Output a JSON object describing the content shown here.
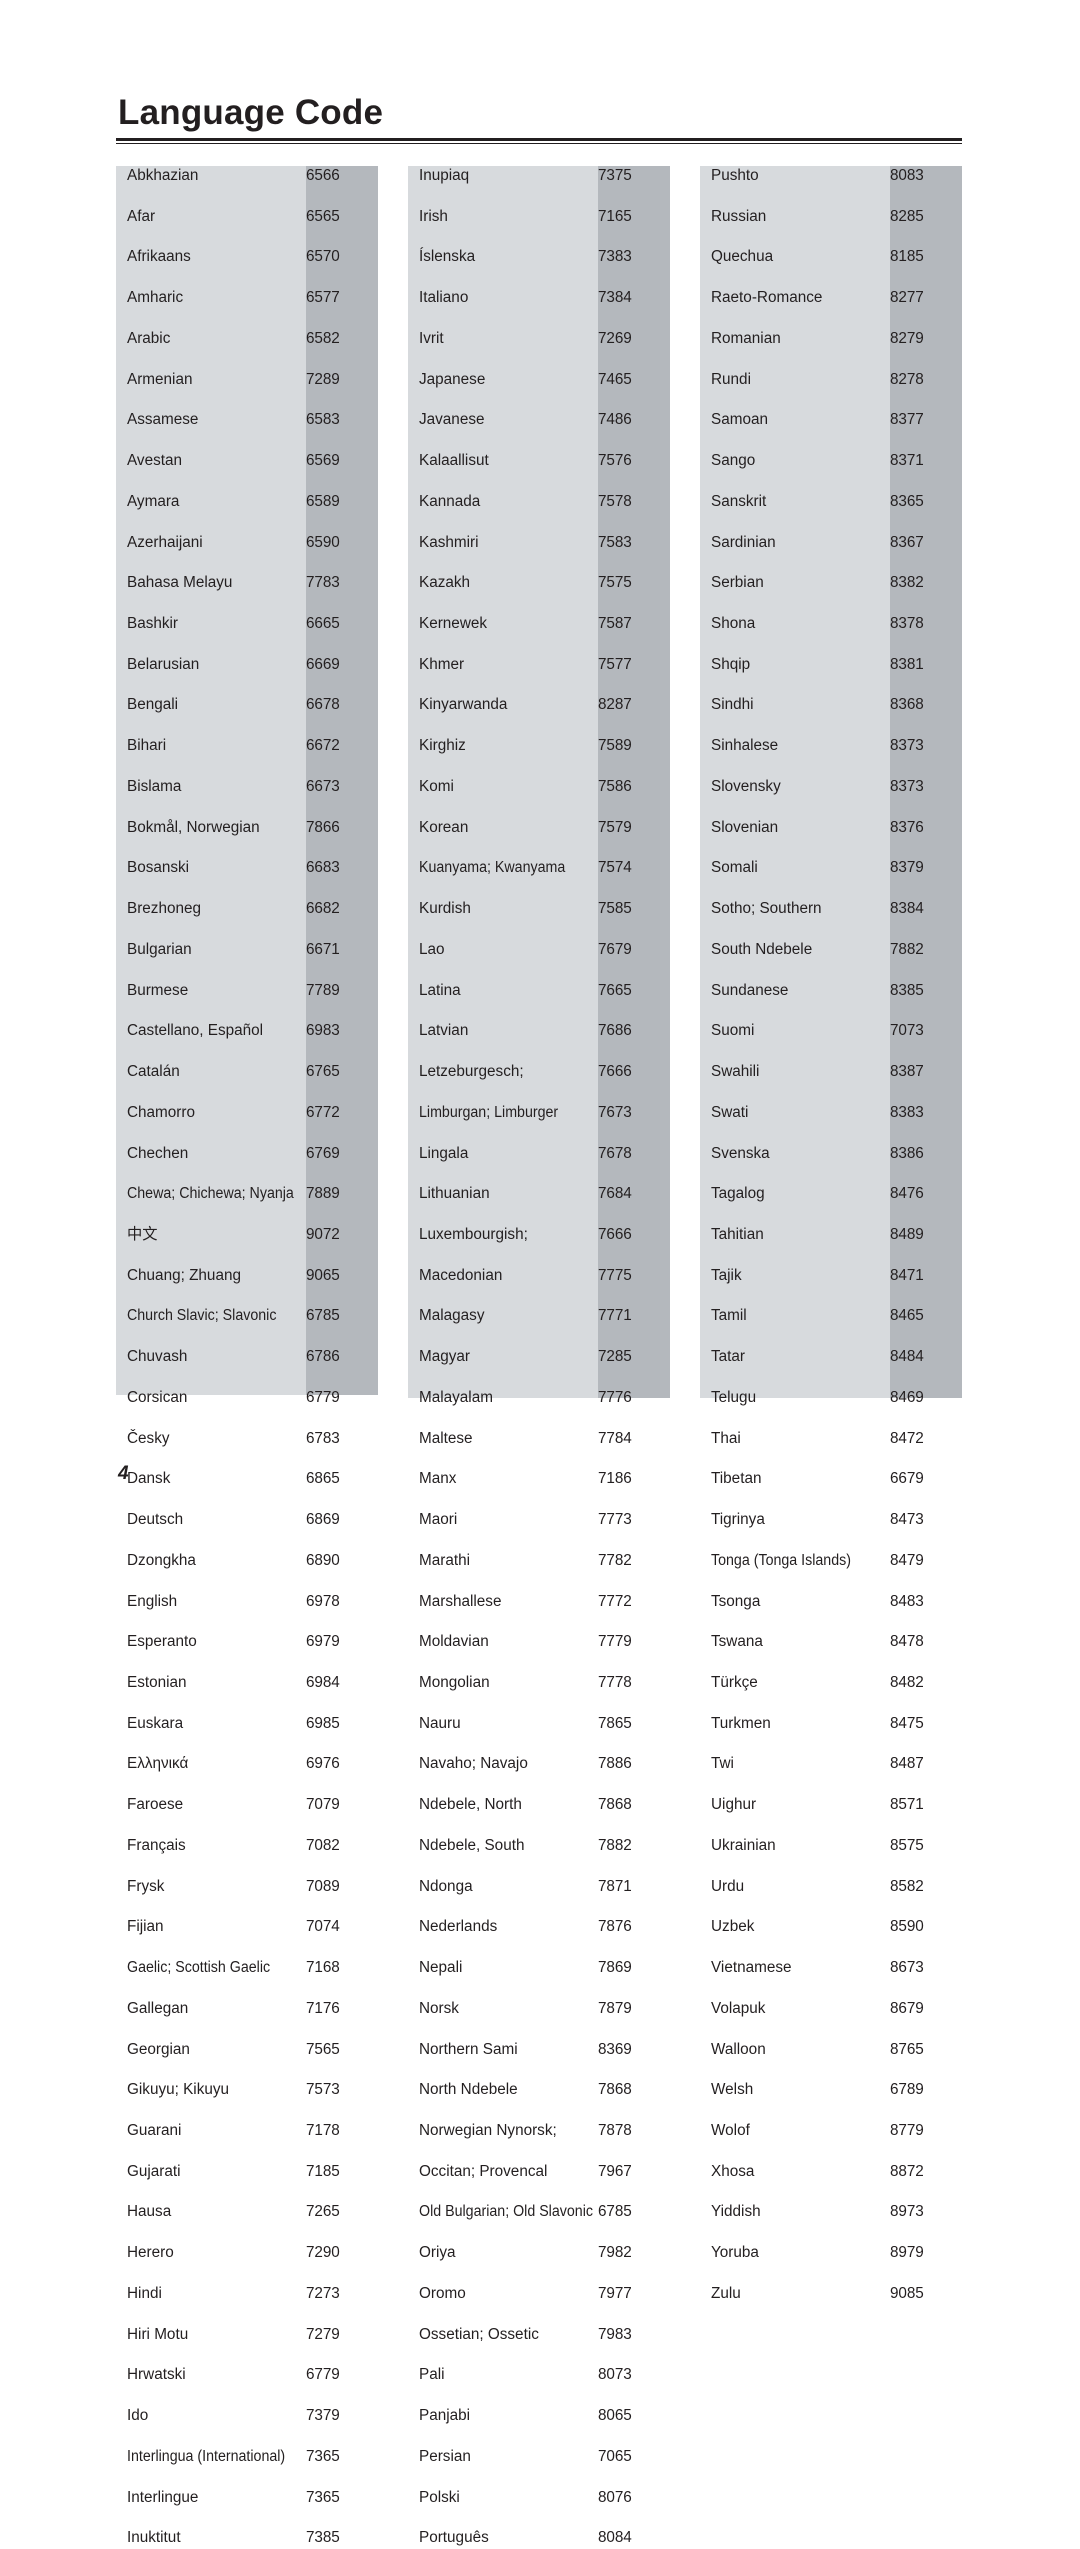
{
  "document": {
    "title": "Language Code",
    "page_number": "4"
  },
  "colors": {
    "name_band": "#d7dadd",
    "code_band": "#b4b8bd",
    "text": "#231f20",
    "rule": "#231f20"
  },
  "table": {
    "columns": [
      {
        "id": "column-1",
        "entries": [
          {
            "language": "Abkhazian",
            "code": "6566"
          },
          {
            "language": "Afar",
            "code": "6565"
          },
          {
            "language": "Afrikaans",
            "code": "6570"
          },
          {
            "language": "Amharic",
            "code": "6577"
          },
          {
            "language": "Arabic",
            "code": "6582"
          },
          {
            "language": "Armenian",
            "code": "7289"
          },
          {
            "language": "Assamese",
            "code": "6583"
          },
          {
            "language": "Avestan",
            "code": "6569"
          },
          {
            "language": "Aymara",
            "code": "6589"
          },
          {
            "language": "Azerhaijani",
            "code": "6590"
          },
          {
            "language": "Bahasa Melayu",
            "code": "7783"
          },
          {
            "language": "Bashkir",
            "code": "6665"
          },
          {
            "language": "Belarusian",
            "code": "6669"
          },
          {
            "language": "Bengali",
            "code": "6678"
          },
          {
            "language": "Bihari",
            "code": "6672"
          },
          {
            "language": "Bislama",
            "code": "6673"
          },
          {
            "language": "Bokmål, Norwegian",
            "code": "7866"
          },
          {
            "language": "Bosanski",
            "code": "6683"
          },
          {
            "language": "Brezhoneg",
            "code": "6682"
          },
          {
            "language": "Bulgarian",
            "code": "6671"
          },
          {
            "language": "Burmese",
            "code": "7789"
          },
          {
            "language": "Castellano, Español",
            "code": "6983"
          },
          {
            "language": "Catalán",
            "code": "6765"
          },
          {
            "language": "Chamorro",
            "code": "6772"
          },
          {
            "language": "Chechen",
            "code": "6769"
          },
          {
            "language": "Chewa; Chichewa; Nyanja",
            "code": "7889",
            "squeeze": true
          },
          {
            "language": "中文",
            "code": "9072"
          },
          {
            "language": "Chuang; Zhuang",
            "code": "9065"
          },
          {
            "language": "Church Slavic; Slavonic",
            "code": "6785",
            "squeeze": true
          },
          {
            "language": "Chuvash",
            "code": "6786"
          },
          {
            "language": "Corsican",
            "code": "6779"
          },
          {
            "language": "Česky",
            "code": "6783"
          },
          {
            "language": "Dansk",
            "code": "6865"
          },
          {
            "language": "Deutsch",
            "code": "6869"
          },
          {
            "language": "Dzongkha",
            "code": "6890"
          },
          {
            "language": "English",
            "code": "6978"
          },
          {
            "language": "Esperanto",
            "code": "6979"
          },
          {
            "language": "Estonian",
            "code": "6984"
          },
          {
            "language": "Euskara",
            "code": "6985"
          },
          {
            "language": "Ελληνικά",
            "code": "6976"
          },
          {
            "language": "Faroese",
            "code": "7079"
          },
          {
            "language": "Français",
            "code": "7082"
          },
          {
            "language": "Frysk",
            "code": "7089"
          },
          {
            "language": "Fijian",
            "code": "7074"
          },
          {
            "language": "Gaelic; Scottish Gaelic",
            "code": "7168",
            "squeeze": true
          },
          {
            "language": "Gallegan",
            "code": "7176"
          },
          {
            "language": "Georgian",
            "code": "7565"
          },
          {
            "language": "Gikuyu; Kikuyu",
            "code": "7573"
          },
          {
            "language": "Guarani",
            "code": "7178"
          },
          {
            "language": "Gujarati",
            "code": "7185"
          },
          {
            "language": "Hausa",
            "code": "7265"
          },
          {
            "language": "Herero",
            "code": "7290"
          },
          {
            "language": "Hindi",
            "code": "7273"
          },
          {
            "language": "Hiri Motu",
            "code": "7279"
          },
          {
            "language": "Hrwatski",
            "code": "6779"
          },
          {
            "language": "Ido",
            "code": "7379"
          },
          {
            "language": "Interlingua (International)",
            "code": "7365",
            "squeeze": true
          },
          {
            "language": "Interlingue",
            "code": "7365"
          },
          {
            "language": "Inuktitut",
            "code": "7385"
          }
        ]
      },
      {
        "id": "column-2",
        "entries": [
          {
            "language": "Inupiaq",
            "code": "7375"
          },
          {
            "language": "Irish",
            "code": "7165"
          },
          {
            "language": "Íslenska",
            "code": "7383"
          },
          {
            "language": "Italiano",
            "code": "7384"
          },
          {
            "language": "Ivrit",
            "code": "7269"
          },
          {
            "language": "Japanese",
            "code": "7465"
          },
          {
            "language": "Javanese",
            "code": "7486"
          },
          {
            "language": "Kalaallisut",
            "code": "7576"
          },
          {
            "language": "Kannada",
            "code": "7578"
          },
          {
            "language": "Kashmiri",
            "code": "7583"
          },
          {
            "language": "Kazakh",
            "code": "7575"
          },
          {
            "language": "Kernewek",
            "code": "7587"
          },
          {
            "language": "Khmer",
            "code": "7577"
          },
          {
            "language": "Kinyarwanda",
            "code": "8287"
          },
          {
            "language": "Kirghiz",
            "code": "7589"
          },
          {
            "language": "Komi",
            "code": "7586"
          },
          {
            "language": "Korean",
            "code": "7579"
          },
          {
            "language": "Kuanyama; Kwanyama",
            "code": "7574",
            "squeeze": true
          },
          {
            "language": "Kurdish",
            "code": "7585"
          },
          {
            "language": "Lao",
            "code": "7679"
          },
          {
            "language": "Latina",
            "code": "7665"
          },
          {
            "language": "Latvian",
            "code": "7686"
          },
          {
            "language": "Letzeburgesch;",
            "code": "7666"
          },
          {
            "language": "Limburgan; Limburger",
            "code": "7673",
            "squeeze": true
          },
          {
            "language": "Lingala",
            "code": "7678"
          },
          {
            "language": "Lithuanian",
            "code": "7684"
          },
          {
            "language": "Luxembourgish;",
            "code": "7666"
          },
          {
            "language": "Macedonian",
            "code": "7775"
          },
          {
            "language": "Malagasy",
            "code": "7771"
          },
          {
            "language": "Magyar",
            "code": "7285"
          },
          {
            "language": "Malayalam",
            "code": "7776"
          },
          {
            "language": "Maltese",
            "code": "7784"
          },
          {
            "language": "Manx",
            "code": "7186"
          },
          {
            "language": "Maori",
            "code": "7773"
          },
          {
            "language": "Marathi",
            "code": "7782"
          },
          {
            "language": "Marshallese",
            "code": "7772"
          },
          {
            "language": "Moldavian",
            "code": "7779"
          },
          {
            "language": "Mongolian",
            "code": "7778"
          },
          {
            "language": "Nauru",
            "code": "7865"
          },
          {
            "language": "Navaho; Navajo",
            "code": "7886"
          },
          {
            "language": "Ndebele, North",
            "code": "7868"
          },
          {
            "language": "Ndebele, South",
            "code": "7882"
          },
          {
            "language": "Ndonga",
            "code": "7871"
          },
          {
            "language": "Nederlands",
            "code": "7876"
          },
          {
            "language": "Nepali",
            "code": "7869"
          },
          {
            "language": "Norsk",
            "code": "7879"
          },
          {
            "language": "Northern Sami",
            "code": "8369"
          },
          {
            "language": "North Ndebele",
            "code": "7868"
          },
          {
            "language": "Norwegian Nynorsk;",
            "code": "7878"
          },
          {
            "language": "Occitan; Provencal",
            "code": "7967"
          },
          {
            "language": "Old Bulgarian; Old Slavonic",
            "code": "6785",
            "squeeze": true
          },
          {
            "language": "Oriya",
            "code": "7982"
          },
          {
            "language": "Oromo",
            "code": "7977"
          },
          {
            "language": "Ossetian; Ossetic",
            "code": "7983"
          },
          {
            "language": "Pali",
            "code": "8073"
          },
          {
            "language": "Panjabi",
            "code": "8065"
          },
          {
            "language": "Persian",
            "code": "7065"
          },
          {
            "language": "Polski",
            "code": "8076"
          },
          {
            "language": "Português",
            "code": "8084"
          }
        ]
      },
      {
        "id": "column-3",
        "entries": [
          {
            "language": "Pushto",
            "code": "8083"
          },
          {
            "language": "Russian",
            "code": "8285"
          },
          {
            "language": "Quechua",
            "code": "8185"
          },
          {
            "language": "Raeto-Romance",
            "code": "8277"
          },
          {
            "language": "Romanian",
            "code": "8279"
          },
          {
            "language": "Rundi",
            "code": "8278"
          },
          {
            "language": "Samoan",
            "code": "8377"
          },
          {
            "language": "Sango",
            "code": "8371"
          },
          {
            "language": "Sanskrit",
            "code": "8365"
          },
          {
            "language": "Sardinian",
            "code": "8367"
          },
          {
            "language": "Serbian",
            "code": "8382"
          },
          {
            "language": "Shona",
            "code": "8378"
          },
          {
            "language": "Shqip",
            "code": "8381"
          },
          {
            "language": "Sindhi",
            "code": "8368"
          },
          {
            "language": "Sinhalese",
            "code": "8373"
          },
          {
            "language": "Slovensky",
            "code": "8373"
          },
          {
            "language": "Slovenian",
            "code": "8376"
          },
          {
            "language": "Somali",
            "code": "8379"
          },
          {
            "language": "Sotho; Southern",
            "code": "8384"
          },
          {
            "language": "South Ndebele",
            "code": "7882"
          },
          {
            "language": "Sundanese",
            "code": "8385"
          },
          {
            "language": "Suomi",
            "code": "7073"
          },
          {
            "language": "Swahili",
            "code": "8387"
          },
          {
            "language": "Swati",
            "code": "8383"
          },
          {
            "language": "Svenska",
            "code": "8386"
          },
          {
            "language": "Tagalog",
            "code": "8476"
          },
          {
            "language": "Tahitian",
            "code": "8489"
          },
          {
            "language": "Tajik",
            "code": "8471"
          },
          {
            "language": "Tamil",
            "code": "8465"
          },
          {
            "language": "Tatar",
            "code": "8484"
          },
          {
            "language": "Telugu",
            "code": "8469"
          },
          {
            "language": "Thai",
            "code": "8472"
          },
          {
            "language": "Tibetan",
            "code": "6679"
          },
          {
            "language": "Tigrinya",
            "code": "8473"
          },
          {
            "language": "Tonga (Tonga Islands)",
            "code": "8479",
            "squeeze": true
          },
          {
            "language": "Tsonga",
            "code": "8483"
          },
          {
            "language": "Tswana",
            "code": "8478"
          },
          {
            "language": "Türkçe",
            "code": "8482"
          },
          {
            "language": "Turkmen",
            "code": "8475"
          },
          {
            "language": "Twi",
            "code": "8487"
          },
          {
            "language": "Uighur",
            "code": "8571"
          },
          {
            "language": "Ukrainian",
            "code": "8575"
          },
          {
            "language": "Urdu",
            "code": "8582"
          },
          {
            "language": "Uzbek",
            "code": "8590"
          },
          {
            "language": "Vietnamese",
            "code": "8673"
          },
          {
            "language": "Volapuk",
            "code": "8679"
          },
          {
            "language": "Walloon",
            "code": "8765"
          },
          {
            "language": "Welsh",
            "code": "6789"
          },
          {
            "language": "Wolof",
            "code": "8779"
          },
          {
            "language": "Xhosa",
            "code": "8872"
          },
          {
            "language": "Yiddish",
            "code": "8973"
          },
          {
            "language": "Yoruba",
            "code": "8979"
          },
          {
            "language": "Zulu",
            "code": "9085"
          }
        ]
      }
    ],
    "band_heights": [
      1229,
      1232,
      1232
    ]
  }
}
